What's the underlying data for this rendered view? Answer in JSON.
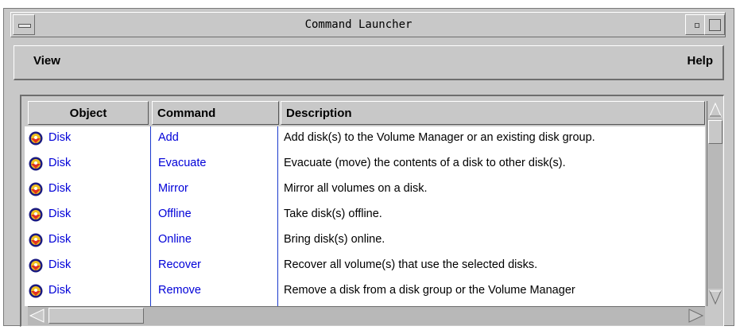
{
  "window": {
    "title": "Command Launcher"
  },
  "menubar": {
    "view_label": "View",
    "help_label": "Help"
  },
  "table": {
    "columns": [
      "Object",
      "Command",
      "Description"
    ],
    "rows": [
      {
        "object": "Disk",
        "command": "Add",
        "description": "Add disk(s) to the Volume Manager or an existing disk group."
      },
      {
        "object": "Disk",
        "command": "Evacuate",
        "description": "Evacuate (move) the contents of a disk to other disk(s)."
      },
      {
        "object": "Disk",
        "command": "Mirror",
        "description": "Mirror all volumes on a disk."
      },
      {
        "object": "Disk",
        "command": "Offline",
        "description": "Take disk(s) offline."
      },
      {
        "object": "Disk",
        "command": "Online",
        "description": "Bring disk(s) online."
      },
      {
        "object": "Disk",
        "command": "Recover",
        "description": "Recover all volume(s) that use the selected disks."
      },
      {
        "object": "Disk",
        "command": "Remove",
        "description": "Remove a disk from a disk group or the Volume Manager"
      }
    ],
    "row_icon": "disk-icon"
  },
  "colors": {
    "link_blue": "#0000d8",
    "window_gray": "#c8c8c8"
  }
}
